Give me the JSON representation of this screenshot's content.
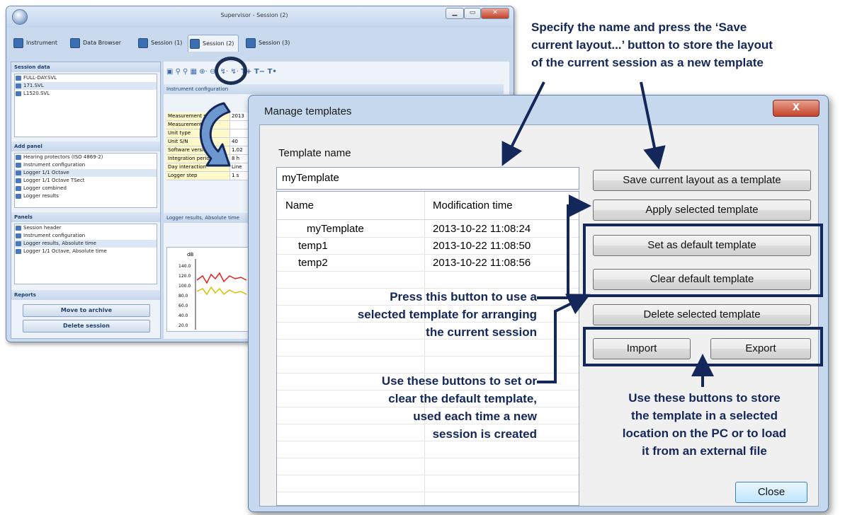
{
  "bg_window": {
    "title": "Supervisor - Session (2)",
    "tabs": [
      "Instrument",
      "Data Browser",
      "Session (1)",
      "Session (2)",
      "Session (3)"
    ],
    "session_data": {
      "header": "Session data",
      "items": [
        "FULL-DAY.SVL",
        "171.SVL",
        "L1520.SVL"
      ]
    },
    "add_panel": {
      "header": "Add panel",
      "items": [
        "Hearing protectors (ISO 4869-2)",
        "Instrument configuration",
        "Logger 1/1 Octave",
        "Logger 1/1 Octave TSect",
        "Logger combined",
        "Logger results"
      ]
    },
    "panels": {
      "header": "Panels",
      "items": [
        "Session header",
        "Instrument configuration",
        "Logger results, Absolute time",
        "Logger 1/1 Octave, Absolute time"
      ]
    },
    "reports": {
      "header": "Reports",
      "move_button": "Move to archive",
      "delete_button": "Delete session"
    },
    "instrument_panel_title": "Instrument configuration",
    "config_rows": [
      [
        "Measurement start",
        "2013"
      ],
      [
        "Measurement stop",
        ""
      ],
      [
        "Unit type",
        ""
      ],
      [
        "Unit S/N",
        "40"
      ],
      [
        "Software version",
        "1.02"
      ],
      [
        "Integration period",
        "8 h"
      ],
      [
        "Day interaction",
        "Line"
      ],
      [
        "Logger step",
        "1 s"
      ]
    ],
    "logger_panel_title": "Logger results, Absolute time",
    "graph_ticks": [
      "140.0",
      "120.0",
      "100.0",
      "80.0",
      "60.0",
      "40.0",
      "20.0"
    ],
    "graph_unit": "dB"
  },
  "dialog": {
    "title": "Manage templates",
    "template_name_label": "Template name",
    "template_name_value": "myTemplate",
    "columns": [
      "Name",
      "Modification time"
    ],
    "rows": [
      {
        "name": "myTemplate",
        "time": "2013-10-22 11:08:24"
      },
      {
        "name": "temp1",
        "time": "2013-10-22 11:08:50"
      },
      {
        "name": "temp2",
        "time": "2013-10-22 11:08:56"
      }
    ],
    "buttons": {
      "save": "Save current layout as a template",
      "apply": "Apply selected template",
      "set_default": "Set as default template",
      "clear_default": "Clear default template",
      "delete": "Delete selected template",
      "import": "Import",
      "export": "Export",
      "close": "Close"
    }
  },
  "annotations": {
    "save_note": [
      "Specify the name and press the ‘Save",
      "current layout...’ button to store the layout",
      "of the current session as a new template"
    ],
    "apply_note": [
      "Press this button to use a",
      "selected template for arranging",
      "the current session"
    ],
    "default_note": [
      "Use these buttons to set or",
      "clear the default template,",
      "used each time a new",
      "session is created"
    ],
    "io_note": [
      "Use these buttons to store",
      "the template in a selected",
      "location on the PC or to load",
      "it from an external file"
    ]
  },
  "colors": {
    "annotation_navy": "#14275a",
    "dialog_frame": "#c5d8ee",
    "close_button_red": "#c5432b"
  }
}
